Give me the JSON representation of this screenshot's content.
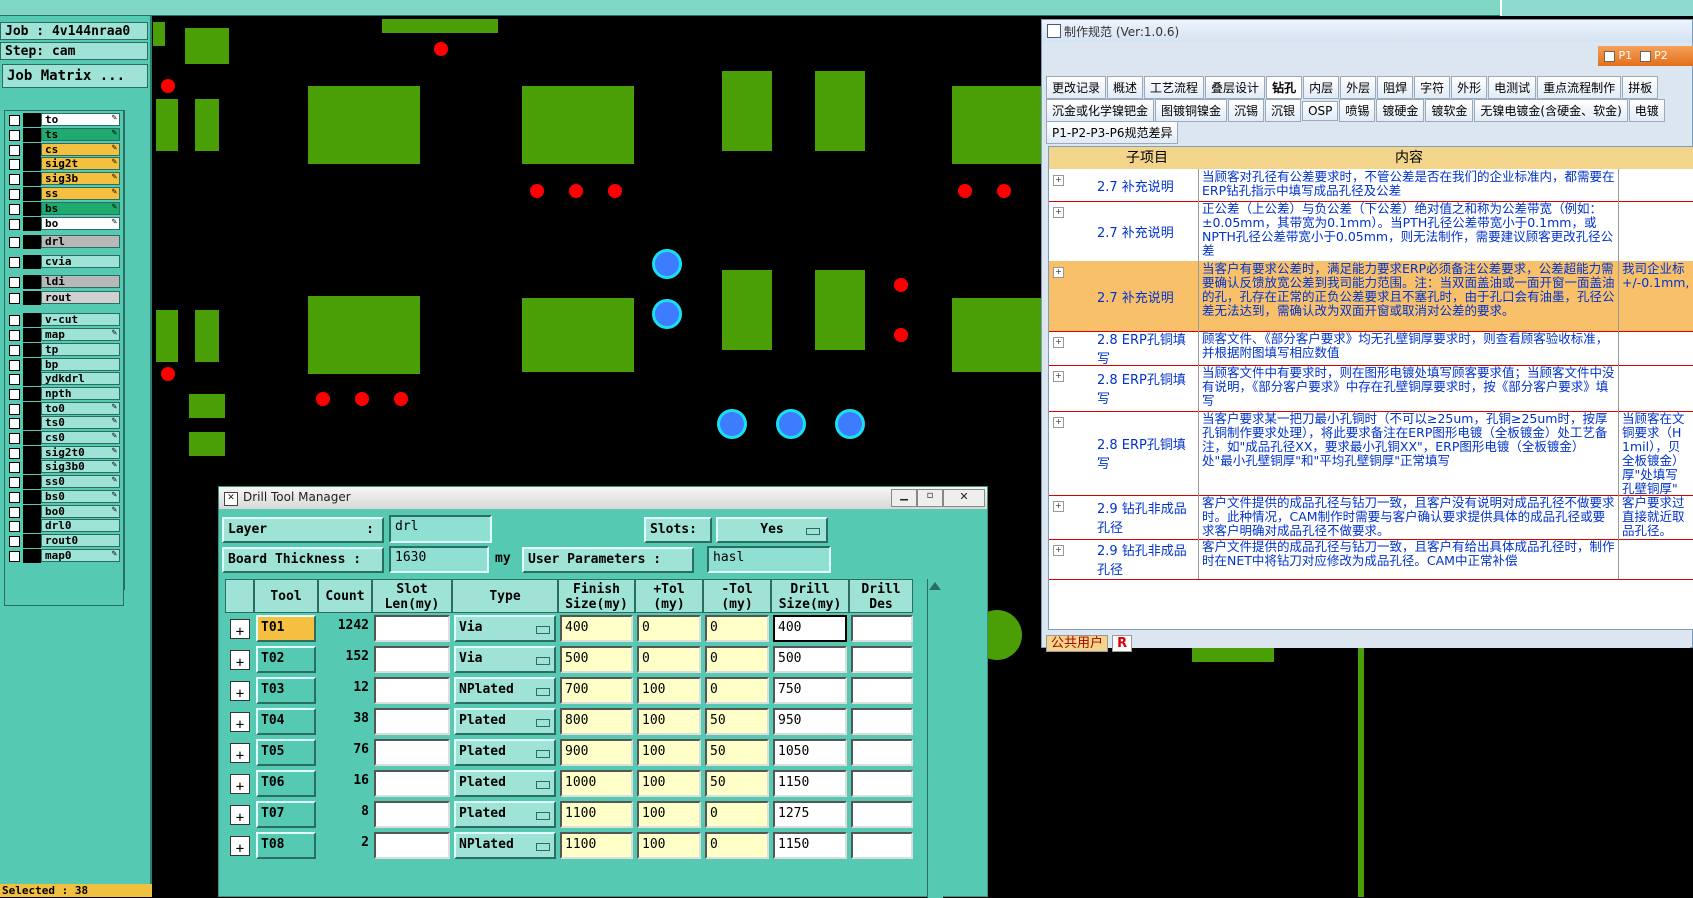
{
  "main": {
    "job": "Job : 4v144nraa0",
    "step": "Step: cam",
    "job_matrix": "Job Matrix ...",
    "selected": "Selected : 38",
    "layers": [
      {
        "name": "to",
        "color": "#ffffff",
        "edit": "✎"
      },
      {
        "name": "ts",
        "color": "#1faa70",
        "edit": "✎"
      },
      {
        "name": "cs",
        "color": "#f5c040",
        "edit": "✎"
      },
      {
        "name": "sig2t",
        "color": "#f5c040",
        "edit": "✎"
      },
      {
        "name": "sig3b",
        "color": "#f5c040",
        "edit": "✎"
      },
      {
        "name": "ss",
        "color": "#f5c040",
        "edit": "✎"
      },
      {
        "name": "bs",
        "color": "#1faa70",
        "edit": "✎"
      },
      {
        "name": "bo",
        "color": "#ffffff",
        "edit": "✎"
      },
      {
        "name": "drl",
        "color": "#b8b8b8",
        "edit": ""
      },
      {
        "name": "cvia",
        "color": "#9ee3d6",
        "edit": ""
      },
      {
        "name": "ldi",
        "color": "#b8b8b8",
        "edit": ""
      },
      {
        "name": "rout",
        "color": "#d0d0d0",
        "edit": ""
      },
      {
        "name": "v-cut",
        "color": "#9ee3d6",
        "edit": ""
      },
      {
        "name": "map",
        "color": "#9ee3d6",
        "edit": "✎"
      },
      {
        "name": "tp",
        "color": "#9ee3d6",
        "edit": ""
      },
      {
        "name": "bp",
        "color": "#9ee3d6",
        "edit": ""
      },
      {
        "name": "ydkdrl",
        "color": "#9ee3d6",
        "edit": ""
      },
      {
        "name": "npth",
        "color": "#9ee3d6",
        "edit": ""
      },
      {
        "name": "to0",
        "color": "#9ee3d6",
        "edit": "✎"
      },
      {
        "name": "ts0",
        "color": "#9ee3d6",
        "edit": "✎"
      },
      {
        "name": "cs0",
        "color": "#9ee3d6",
        "edit": "✎"
      },
      {
        "name": "sig2t0",
        "color": "#9ee3d6",
        "edit": "✎"
      },
      {
        "name": "sig3b0",
        "color": "#9ee3d6",
        "edit": "✎"
      },
      {
        "name": "ss0",
        "color": "#9ee3d6",
        "edit": "✎"
      },
      {
        "name": "bs0",
        "color": "#9ee3d6",
        "edit": "✎"
      },
      {
        "name": "bo0",
        "color": "#9ee3d6",
        "edit": "✎"
      },
      {
        "name": "drl0",
        "color": "#9ee3d6",
        "edit": ""
      },
      {
        "name": "rout0",
        "color": "#9ee3d6",
        "edit": ""
      },
      {
        "name": "map0",
        "color": "#9ee3d6",
        "edit": "✎"
      }
    ]
  },
  "spec": {
    "title": "制作规范 (Ver:1.0.6)",
    "chk_p1": "P1",
    "chk_p2": "P2",
    "tabs1": [
      "更改记录",
      "概述",
      "工艺流程",
      "叠层设计",
      "钻孔",
      "内层",
      "外层",
      "阻焊",
      "字符",
      "外形",
      "电测试",
      "重点流程制作",
      "拼板"
    ],
    "tabs2": [
      "沉金或化学镍钯金",
      "图镀铜镍金",
      "沉锡",
      "沉银",
      "OSP",
      "喷锡",
      "镀硬金",
      "镀软金",
      "无镍电镀金(含硬金、软金)",
      "电镀"
    ],
    "tabs3": [
      "P1-P2-P3-P6规范差异"
    ],
    "col_sub": "子项目",
    "col_content": "内容",
    "rows": [
      {
        "sub": "2.7 补充说明",
        "content": "当顾客对孔径有公差要求时，不管公差是否在我们的企业标准内，都需要在ERP钻孔指示中填写成品孔径及公差",
        "extra": ""
      },
      {
        "sub": "2.7 补充说明",
        "content": "正公差（上公差）与负公差（下公差）绝对值之和称为公差带宽（例如：±0.05mm，其带宽为0.1mm）。当PTH孔径公差带宽小于0.1mm，或NPTH孔径公差带宽小于0.05mm，则无法制作，需要建议顾客更改孔径公差",
        "extra": ""
      },
      {
        "sub": "2.7 补充说明",
        "content": "当客户有要求公差时，满足能力要求ERP必须备注公差要求，公差超能力需要确认反馈放宽公差到我司能力范围。注：当双面盖油或一面开窗一面盖油的孔，孔存在正常的正负公差要求且不塞孔时，由于孔口会有油墨，孔径公差无法达到，需确认改为双面开窗或取消对公差的要求。",
        "extra": "我司企业标 +/-0.1mm,"
      },
      {
        "sub": "2.8 ERP孔铜填写",
        "content": "顾客文件、《部分客户要求》均无孔壁铜厚要求时，则查看顾客验收标准，并根据附图填写相应数值",
        "extra": ""
      },
      {
        "sub": "2.8 ERP孔铜填写",
        "content": "当顾客文件中有要求时，则在图形电镀处填写顾客要求值；当顾客文件中没有说明，《部分客户要求》中存在孔壁铜厚要求时，按《部分客户要求》填写",
        "extra": ""
      },
      {
        "sub": "2.8 ERP孔铜填写",
        "content": "当客户要求某一把刀最小孔铜时（不可以≥25um，孔铜≥25um时，按厚孔铜制作要求处理），将此要求备注在ERP图形电镀（全板镀金）处工艺备注，如\"成品孔径XX，要求最小孔铜XX\"，ERP图形电镀（全板镀金）处\"最小孔壁铜厚\"和\"平均孔壁铜厚\"正常填写",
        "extra": "当顾客在文 铜要求（H 1mil），贝 全板镀金） 厚\"处填写 孔壁铜厚\""
      },
      {
        "sub": "2.9 钻孔非成品孔径",
        "content": "客户文件提供的成品孔径与钻刀一致，且客户没有说明对成品孔径不做要求时。此种情况，CAM制作时需要与客户确认要求提供具体的成品孔径或要求客户明确对成品孔径不做要求。",
        "extra": "客户要求过 直接就近取 品孔径。"
      },
      {
        "sub": "2.9 钻孔非成品孔径",
        "content": "客户文件提供的成品孔径与钻刀一致，且客户有给出具体成品孔径时，制作时在NET中将钻刀对应修改为成品孔径。CAM中正常补偿",
        "extra": ""
      }
    ],
    "status_user": "公共用户",
    "status_r": "R"
  },
  "dtm": {
    "title": "Drill Tool Manager",
    "layer_label": "Layer",
    "layer_sep": ":",
    "layer_value": "drl",
    "slots_label": "Slots:",
    "slots_value": "Yes",
    "thick_label": "Board Thickness :",
    "thick_value": "1630",
    "thick_unit": "my",
    "user_params_label": "User Parameters :",
    "user_params_value": "hasl",
    "headers": {
      "tool": "Tool",
      "count": "Count",
      "slot": "Slot\nLen(my)",
      "type": "Type",
      "finish": "Finish\nSize(my)",
      "ptol": "+Tol\n(my)",
      "ntol": "-Tol\n(my)",
      "drill": "Drill\nSize(my)",
      "des": "Drill\nDes"
    },
    "tools": [
      {
        "tool": "T01",
        "count": "1242",
        "type": "Via",
        "finish": "400",
        "ptol": "0",
        "ntol": "0",
        "drill": "400"
      },
      {
        "tool": "T02",
        "count": "152",
        "type": "Via",
        "finish": "500",
        "ptol": "0",
        "ntol": "0",
        "drill": "500"
      },
      {
        "tool": "T03",
        "count": "12",
        "type": "NPlated",
        "finish": "700",
        "ptol": "100",
        "ntol": "0",
        "drill": "750"
      },
      {
        "tool": "T04",
        "count": "38",
        "type": "Plated",
        "finish": "800",
        "ptol": "100",
        "ntol": "50",
        "drill": "950"
      },
      {
        "tool": "T05",
        "count": "76",
        "type": "Plated",
        "finish": "900",
        "ptol": "100",
        "ntol": "50",
        "drill": "1050"
      },
      {
        "tool": "T06",
        "count": "16",
        "type": "Plated",
        "finish": "1000",
        "ptol": "100",
        "ntol": "50",
        "drill": "1150"
      },
      {
        "tool": "T07",
        "count": "8",
        "type": "Plated",
        "finish": "1100",
        "ptol": "100",
        "ntol": "0",
        "drill": "1275"
      },
      {
        "tool": "T08",
        "count": "2",
        "type": "NPlated",
        "finish": "1100",
        "ptol": "100",
        "ntol": "0",
        "drill": "1150"
      }
    ]
  },
  "colors": {
    "board_bg": "#000000",
    "pad_green": "#4a9f07",
    "panel_teal": "#56c9b3",
    "highlight": "#f9c06a"
  }
}
